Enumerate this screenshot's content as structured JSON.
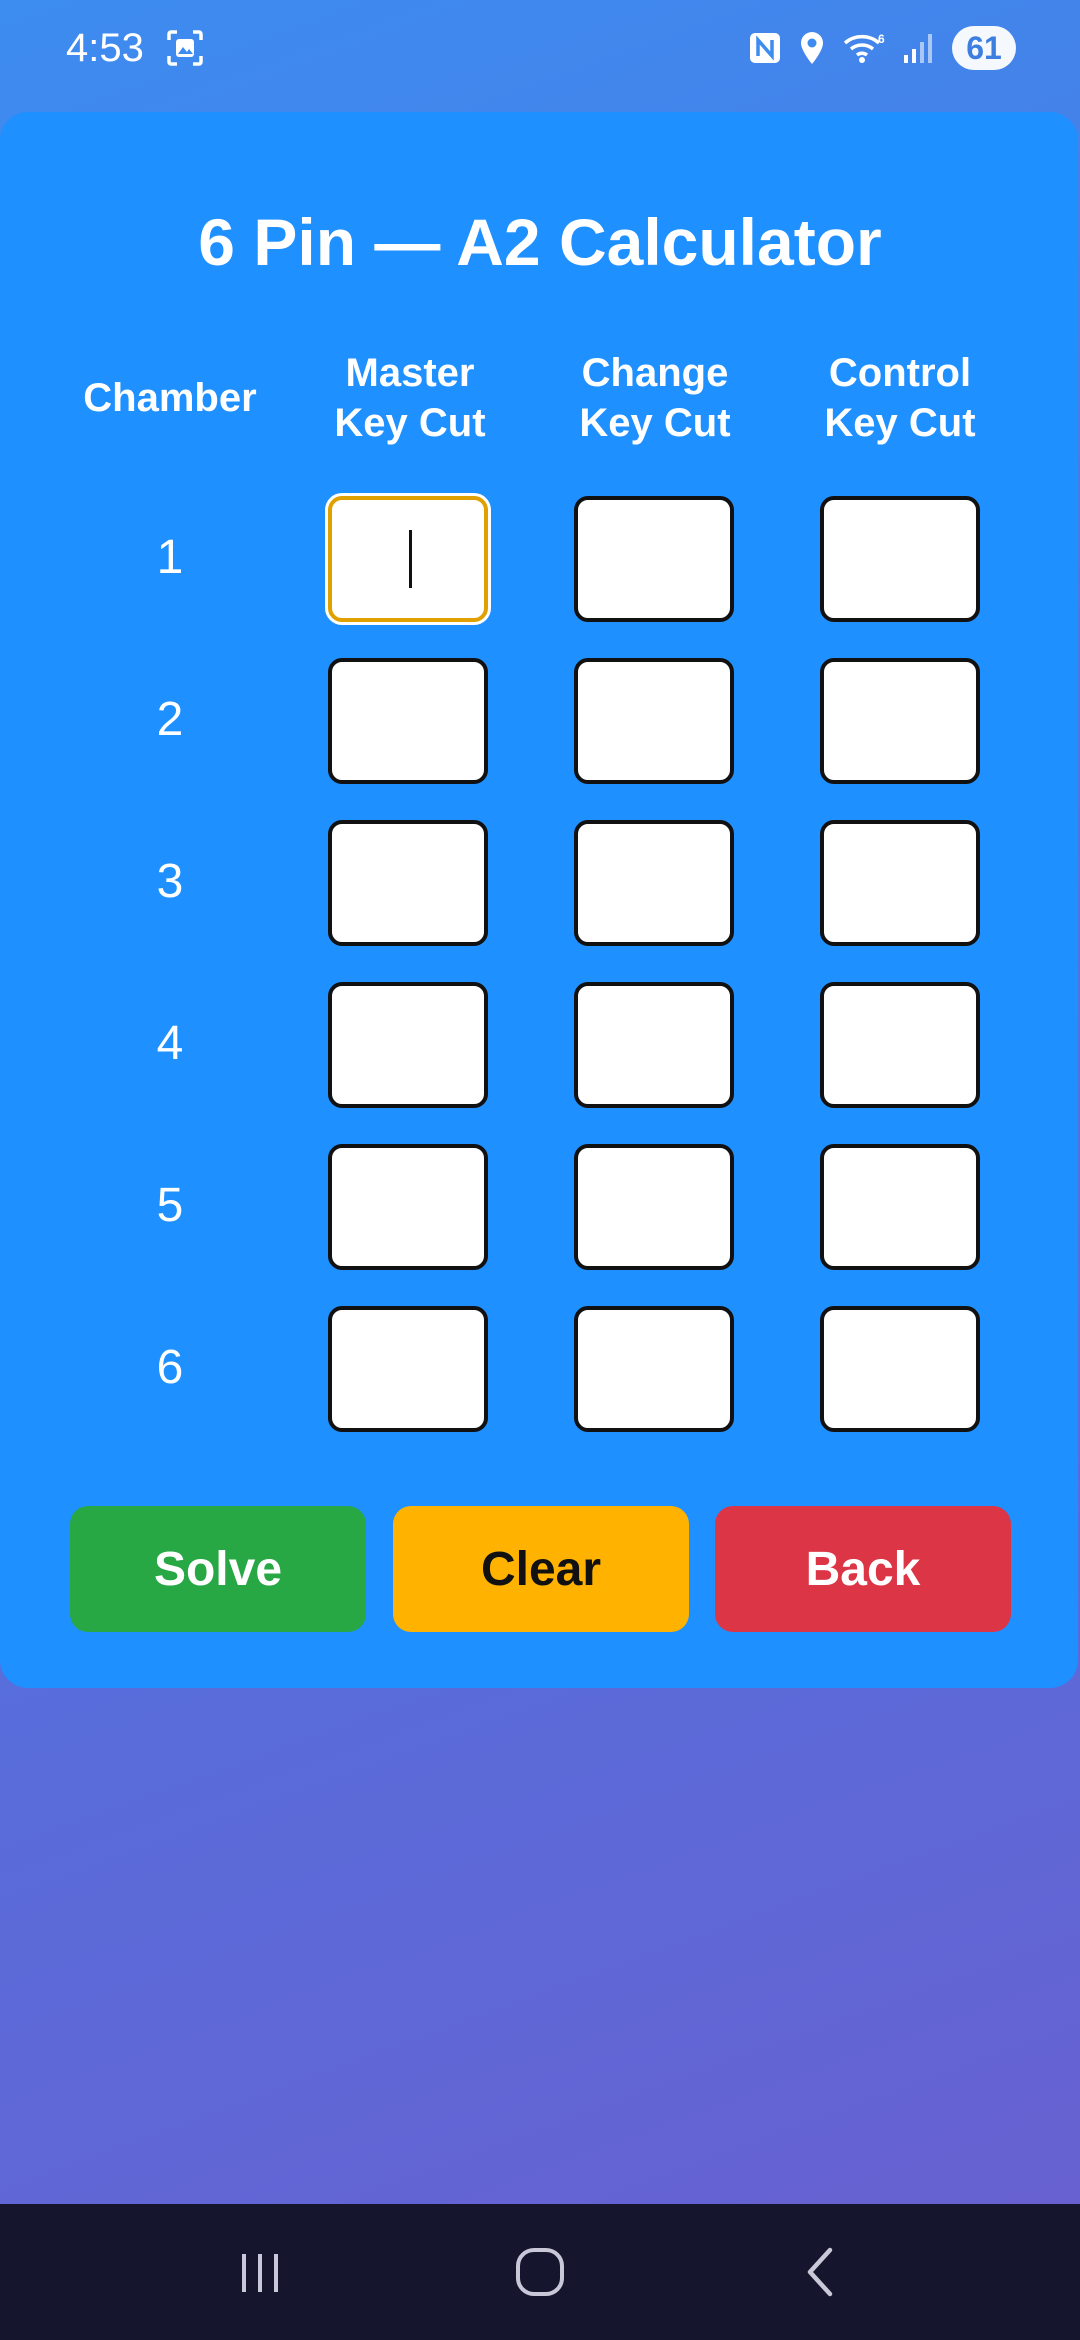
{
  "status_bar": {
    "time": "4:53",
    "battery": "61",
    "icons": [
      "screenshot-icon",
      "nfc-icon",
      "location-icon",
      "wifi-icon",
      "signal-icon",
      "battery-icon"
    ]
  },
  "calculator": {
    "title": "6 Pin — A2 Calculator",
    "headers": {
      "chamber": "Chamber",
      "master": [
        "Master",
        "Key Cut"
      ],
      "change": [
        "Change",
        "Key Cut"
      ],
      "control": [
        "Control",
        "Key Cut"
      ]
    },
    "rows": [
      {
        "chamber": "1",
        "master": "",
        "change": "",
        "control": ""
      },
      {
        "chamber": "2",
        "master": "",
        "change": "",
        "control": ""
      },
      {
        "chamber": "3",
        "master": "",
        "change": "",
        "control": ""
      },
      {
        "chamber": "4",
        "master": "",
        "change": "",
        "control": ""
      },
      {
        "chamber": "5",
        "master": "",
        "change": "",
        "control": ""
      },
      {
        "chamber": "6",
        "master": "",
        "change": "",
        "control": ""
      }
    ]
  },
  "actions": {
    "solve": "Solve",
    "clear": "Clear",
    "back": "Back"
  },
  "colors": {
    "card": "#1e90ff",
    "solve": "#28a745",
    "clear": "#ffb300",
    "back": "#dc3545",
    "focus": "#e0a000"
  },
  "nav_bar": {
    "icons": [
      "recent-apps-icon",
      "home-icon",
      "back-icon"
    ]
  }
}
